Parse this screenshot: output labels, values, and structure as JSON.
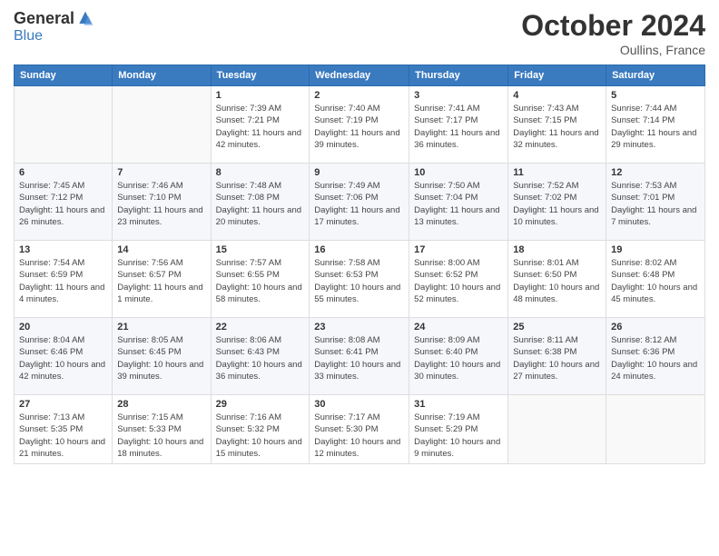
{
  "header": {
    "logo_general": "General",
    "logo_blue": "Blue",
    "month_title": "October 2024",
    "location": "Oullins, France"
  },
  "weekdays": [
    "Sunday",
    "Monday",
    "Tuesday",
    "Wednesday",
    "Thursday",
    "Friday",
    "Saturday"
  ],
  "weeks": [
    [
      {
        "day": "",
        "sunrise": "",
        "sunset": "",
        "daylight": ""
      },
      {
        "day": "",
        "sunrise": "",
        "sunset": "",
        "daylight": ""
      },
      {
        "day": "1",
        "sunrise": "Sunrise: 7:39 AM",
        "sunset": "Sunset: 7:21 PM",
        "daylight": "Daylight: 11 hours and 42 minutes."
      },
      {
        "day": "2",
        "sunrise": "Sunrise: 7:40 AM",
        "sunset": "Sunset: 7:19 PM",
        "daylight": "Daylight: 11 hours and 39 minutes."
      },
      {
        "day": "3",
        "sunrise": "Sunrise: 7:41 AM",
        "sunset": "Sunset: 7:17 PM",
        "daylight": "Daylight: 11 hours and 36 minutes."
      },
      {
        "day": "4",
        "sunrise": "Sunrise: 7:43 AM",
        "sunset": "Sunset: 7:15 PM",
        "daylight": "Daylight: 11 hours and 32 minutes."
      },
      {
        "day": "5",
        "sunrise": "Sunrise: 7:44 AM",
        "sunset": "Sunset: 7:14 PM",
        "daylight": "Daylight: 11 hours and 29 minutes."
      }
    ],
    [
      {
        "day": "6",
        "sunrise": "Sunrise: 7:45 AM",
        "sunset": "Sunset: 7:12 PM",
        "daylight": "Daylight: 11 hours and 26 minutes."
      },
      {
        "day": "7",
        "sunrise": "Sunrise: 7:46 AM",
        "sunset": "Sunset: 7:10 PM",
        "daylight": "Daylight: 11 hours and 23 minutes."
      },
      {
        "day": "8",
        "sunrise": "Sunrise: 7:48 AM",
        "sunset": "Sunset: 7:08 PM",
        "daylight": "Daylight: 11 hours and 20 minutes."
      },
      {
        "day": "9",
        "sunrise": "Sunrise: 7:49 AM",
        "sunset": "Sunset: 7:06 PM",
        "daylight": "Daylight: 11 hours and 17 minutes."
      },
      {
        "day": "10",
        "sunrise": "Sunrise: 7:50 AM",
        "sunset": "Sunset: 7:04 PM",
        "daylight": "Daylight: 11 hours and 13 minutes."
      },
      {
        "day": "11",
        "sunrise": "Sunrise: 7:52 AM",
        "sunset": "Sunset: 7:02 PM",
        "daylight": "Daylight: 11 hours and 10 minutes."
      },
      {
        "day": "12",
        "sunrise": "Sunrise: 7:53 AM",
        "sunset": "Sunset: 7:01 PM",
        "daylight": "Daylight: 11 hours and 7 minutes."
      }
    ],
    [
      {
        "day": "13",
        "sunrise": "Sunrise: 7:54 AM",
        "sunset": "Sunset: 6:59 PM",
        "daylight": "Daylight: 11 hours and 4 minutes."
      },
      {
        "day": "14",
        "sunrise": "Sunrise: 7:56 AM",
        "sunset": "Sunset: 6:57 PM",
        "daylight": "Daylight: 11 hours and 1 minute."
      },
      {
        "day": "15",
        "sunrise": "Sunrise: 7:57 AM",
        "sunset": "Sunset: 6:55 PM",
        "daylight": "Daylight: 10 hours and 58 minutes."
      },
      {
        "day": "16",
        "sunrise": "Sunrise: 7:58 AM",
        "sunset": "Sunset: 6:53 PM",
        "daylight": "Daylight: 10 hours and 55 minutes."
      },
      {
        "day": "17",
        "sunrise": "Sunrise: 8:00 AM",
        "sunset": "Sunset: 6:52 PM",
        "daylight": "Daylight: 10 hours and 52 minutes."
      },
      {
        "day": "18",
        "sunrise": "Sunrise: 8:01 AM",
        "sunset": "Sunset: 6:50 PM",
        "daylight": "Daylight: 10 hours and 48 minutes."
      },
      {
        "day": "19",
        "sunrise": "Sunrise: 8:02 AM",
        "sunset": "Sunset: 6:48 PM",
        "daylight": "Daylight: 10 hours and 45 minutes."
      }
    ],
    [
      {
        "day": "20",
        "sunrise": "Sunrise: 8:04 AM",
        "sunset": "Sunset: 6:46 PM",
        "daylight": "Daylight: 10 hours and 42 minutes."
      },
      {
        "day": "21",
        "sunrise": "Sunrise: 8:05 AM",
        "sunset": "Sunset: 6:45 PM",
        "daylight": "Daylight: 10 hours and 39 minutes."
      },
      {
        "day": "22",
        "sunrise": "Sunrise: 8:06 AM",
        "sunset": "Sunset: 6:43 PM",
        "daylight": "Daylight: 10 hours and 36 minutes."
      },
      {
        "day": "23",
        "sunrise": "Sunrise: 8:08 AM",
        "sunset": "Sunset: 6:41 PM",
        "daylight": "Daylight: 10 hours and 33 minutes."
      },
      {
        "day": "24",
        "sunrise": "Sunrise: 8:09 AM",
        "sunset": "Sunset: 6:40 PM",
        "daylight": "Daylight: 10 hours and 30 minutes."
      },
      {
        "day": "25",
        "sunrise": "Sunrise: 8:11 AM",
        "sunset": "Sunset: 6:38 PM",
        "daylight": "Daylight: 10 hours and 27 minutes."
      },
      {
        "day": "26",
        "sunrise": "Sunrise: 8:12 AM",
        "sunset": "Sunset: 6:36 PM",
        "daylight": "Daylight: 10 hours and 24 minutes."
      }
    ],
    [
      {
        "day": "27",
        "sunrise": "Sunrise: 7:13 AM",
        "sunset": "Sunset: 5:35 PM",
        "daylight": "Daylight: 10 hours and 21 minutes."
      },
      {
        "day": "28",
        "sunrise": "Sunrise: 7:15 AM",
        "sunset": "Sunset: 5:33 PM",
        "daylight": "Daylight: 10 hours and 18 minutes."
      },
      {
        "day": "29",
        "sunrise": "Sunrise: 7:16 AM",
        "sunset": "Sunset: 5:32 PM",
        "daylight": "Daylight: 10 hours and 15 minutes."
      },
      {
        "day": "30",
        "sunrise": "Sunrise: 7:17 AM",
        "sunset": "Sunset: 5:30 PM",
        "daylight": "Daylight: 10 hours and 12 minutes."
      },
      {
        "day": "31",
        "sunrise": "Sunrise: 7:19 AM",
        "sunset": "Sunset: 5:29 PM",
        "daylight": "Daylight: 10 hours and 9 minutes."
      },
      {
        "day": "",
        "sunrise": "",
        "sunset": "",
        "daylight": ""
      },
      {
        "day": "",
        "sunrise": "",
        "sunset": "",
        "daylight": ""
      }
    ]
  ]
}
